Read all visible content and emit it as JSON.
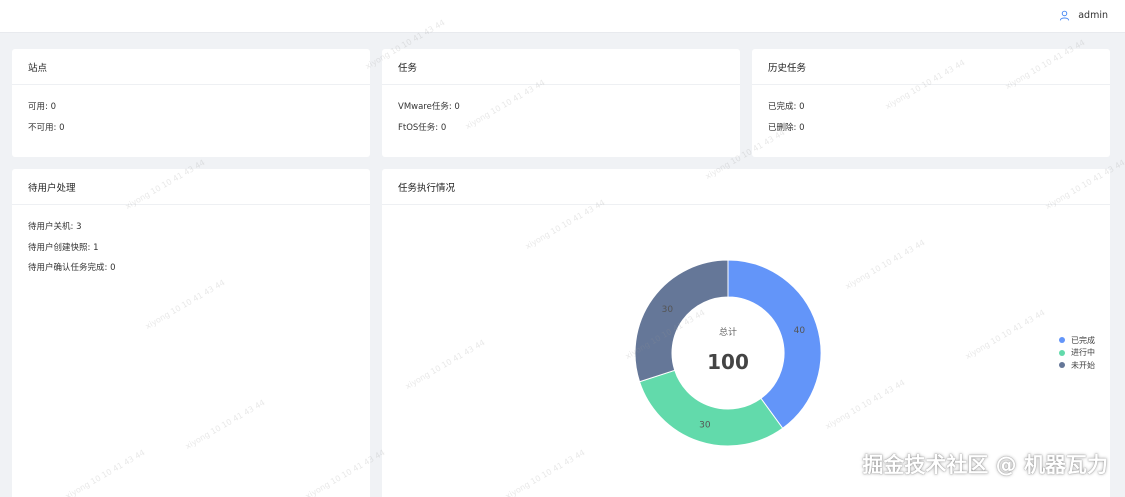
{
  "header": {
    "username": "admin"
  },
  "cards": {
    "sites": {
      "title": "站点",
      "lines": [
        "可用: 0",
        "不可用: 0"
      ]
    },
    "tasks": {
      "title": "任务",
      "lines": [
        "VMware任务: 0",
        "FtOS任务: 0"
      ]
    },
    "history": {
      "title": "历史任务",
      "lines": [
        "已完成: 0",
        "已删除: 0"
      ]
    },
    "pending": {
      "title": "待用户处理",
      "lines": [
        "待用户关机: 3",
        "待用户创建快照: 1",
        "待用户确认任务完成: 0"
      ]
    },
    "execution": {
      "title": "任务执行情况"
    }
  },
  "chart_data": {
    "type": "pie",
    "center_label": "总计",
    "center_value": "100",
    "categories": [
      "已完成",
      "进行中",
      "未开始"
    ],
    "values": [
      40,
      30,
      30
    ],
    "colors": [
      "#6395f9",
      "#62daab",
      "#657798"
    ]
  },
  "watermark": {
    "text": "xiyong 10 10 41 43 44"
  },
  "footer_watermark": "掘金技术社区 @ 机器瓦力"
}
